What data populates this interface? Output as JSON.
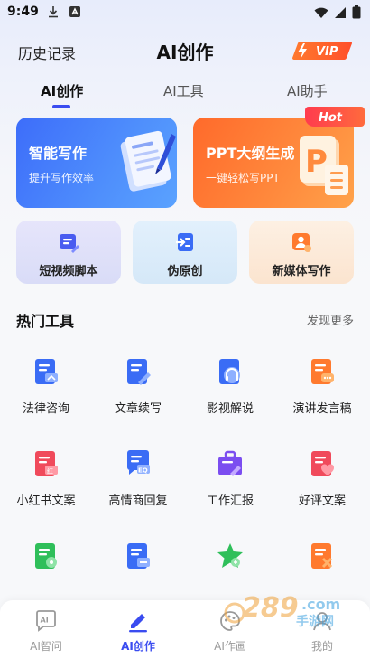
{
  "status": {
    "time": "9:49"
  },
  "header": {
    "history_label": "历史记录",
    "title": "AI创作",
    "vip_label": "VIP"
  },
  "tabs": [
    {
      "label": "AI创作",
      "active": true
    },
    {
      "label": "AI工具",
      "active": false
    },
    {
      "label": "AI助手",
      "active": false
    }
  ],
  "feature_cards": [
    {
      "title": "智能写作",
      "subtitle": "提升写作效率",
      "icon": "document-pen-icon"
    },
    {
      "title": "PPT大纲生成",
      "subtitle": "一键轻松写PPT",
      "icon": "ppt-icon",
      "badge": "Hot"
    }
  ],
  "quick_cards": [
    {
      "label": "短视频脚本",
      "icon": "video-script-icon"
    },
    {
      "label": "伪原创",
      "icon": "rewrite-icon"
    },
    {
      "label": "新媒体写作",
      "icon": "new-media-icon"
    }
  ],
  "hot_tools": {
    "title": "热门工具",
    "more_label": "发现更多",
    "items": [
      {
        "label": "法律咨询",
        "icon": "law-doc-icon",
        "color": "#3a6cf5"
      },
      {
        "label": "文章续写",
        "icon": "article-pen-icon",
        "color": "#3a6cf5"
      },
      {
        "label": "影视解说",
        "icon": "headphone-doc-icon",
        "color": "#3a6cf5"
      },
      {
        "label": "演讲发言稿",
        "icon": "speech-doc-icon",
        "color": "#ff7a2e"
      },
      {
        "label": "小红书文案",
        "icon": "redbook-doc-icon",
        "color": "#f04a5b"
      },
      {
        "label": "高情商回复",
        "icon": "eq-chat-icon",
        "color": "#3a6cf5"
      },
      {
        "label": "工作汇报",
        "icon": "briefcase-icon",
        "color": "#7b4df0"
      },
      {
        "label": "好评文案",
        "icon": "heart-doc-icon",
        "color": "#f04a5b"
      },
      {
        "label": "",
        "icon": "green-doc-icon",
        "color": "#2fbf5a"
      },
      {
        "label": "",
        "icon": "blue-doc-icon",
        "color": "#3a6cf5"
      },
      {
        "label": "",
        "icon": "green-star-icon",
        "color": "#2fbf5a"
      },
      {
        "label": "",
        "icon": "orange-doc-icon",
        "color": "#ff7a2e"
      }
    ]
  },
  "bottom_nav": [
    {
      "label": "AI智问",
      "icon": "ai-chat-icon",
      "active": false
    },
    {
      "label": "AI创作",
      "icon": "pen-icon",
      "active": true
    },
    {
      "label": "AI作画",
      "icon": "paint-icon",
      "active": false
    },
    {
      "label": "我的",
      "icon": "profile-icon",
      "active": false
    }
  ],
  "colors": {
    "accent": "#3a4cf0",
    "orange": "#ff7a2e"
  }
}
